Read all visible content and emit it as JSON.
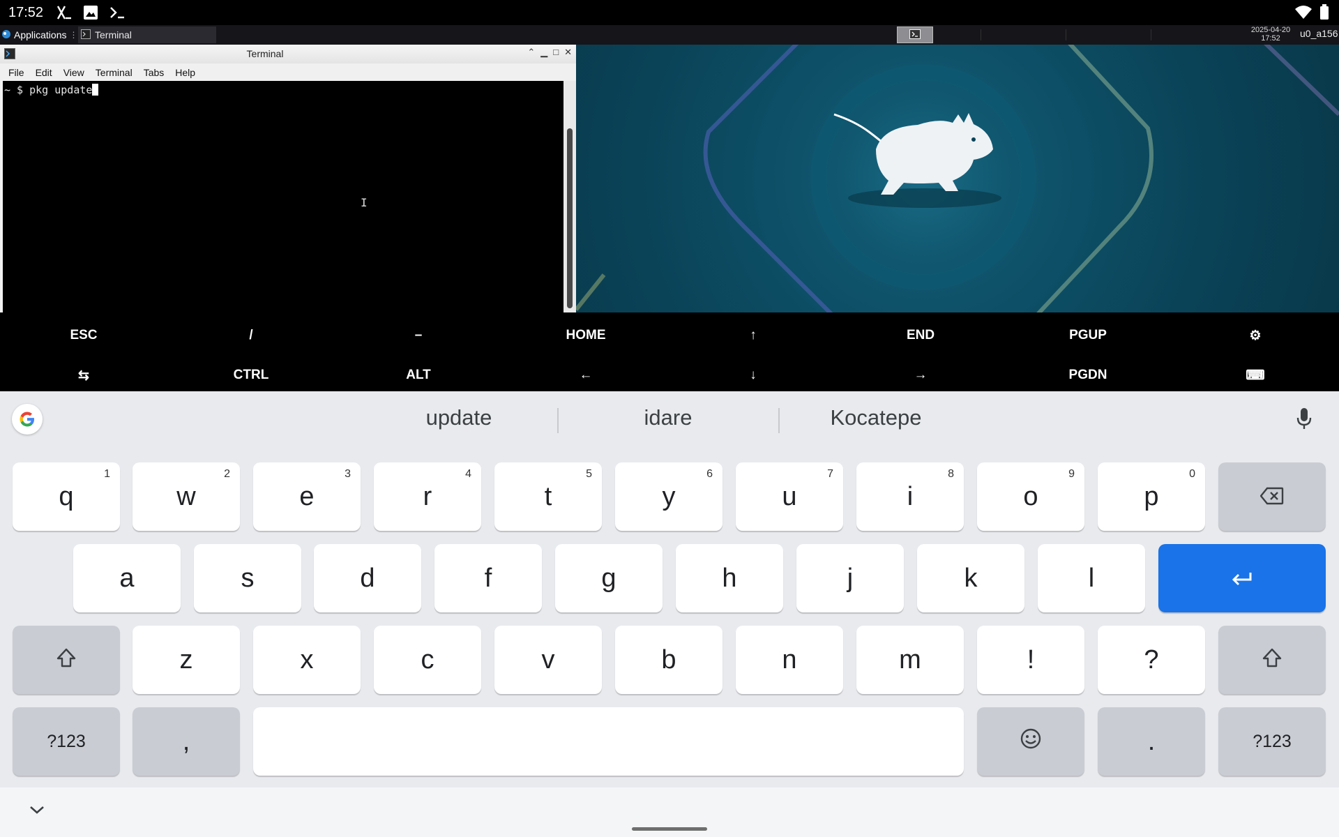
{
  "status_bar": {
    "time": "17:52",
    "icons": [
      "x-app-icon",
      "image-icon",
      "terminal-prompt-icon"
    ],
    "right_icons": [
      "wifi-icon",
      "battery-icon"
    ]
  },
  "panel": {
    "apps_menu_label": "Applications",
    "task_label": "Terminal",
    "clock_date": "2025-04-20",
    "clock_time": "17:52",
    "user": "u0_a156"
  },
  "terminal": {
    "title": "Terminal",
    "menu": [
      "File",
      "Edit",
      "View",
      "Terminal",
      "Tabs",
      "Help"
    ],
    "prompt": "~ $ ",
    "command": "pkg update"
  },
  "extra_keys": {
    "row1": [
      "ESC",
      "/",
      "–",
      "HOME",
      "↑",
      "END",
      "PGUP",
      "⚙"
    ],
    "row2": [
      "⇆",
      "CTRL",
      "ALT",
      "←",
      "↓",
      "→",
      "PGDN",
      "⌨"
    ]
  },
  "keyboard": {
    "suggestions": [
      "update",
      "idare",
      "Kocatepe"
    ],
    "row1": [
      {
        "k": "q",
        "h": "1"
      },
      {
        "k": "w",
        "h": "2"
      },
      {
        "k": "e",
        "h": "3"
      },
      {
        "k": "r",
        "h": "4"
      },
      {
        "k": "t",
        "h": "5"
      },
      {
        "k": "y",
        "h": "6"
      },
      {
        "k": "u",
        "h": "7"
      },
      {
        "k": "i",
        "h": "8"
      },
      {
        "k": "o",
        "h": "9"
      },
      {
        "k": "p",
        "h": "0"
      }
    ],
    "row2": [
      "a",
      "s",
      "d",
      "f",
      "g",
      "h",
      "j",
      "k",
      "l"
    ],
    "row3": [
      "z",
      "x",
      "c",
      "v",
      "b",
      "n",
      "m",
      "!",
      "?"
    ],
    "symbols_label": "?123",
    "comma": ",",
    "period": ".",
    "enter_color": "#1a73e8"
  }
}
